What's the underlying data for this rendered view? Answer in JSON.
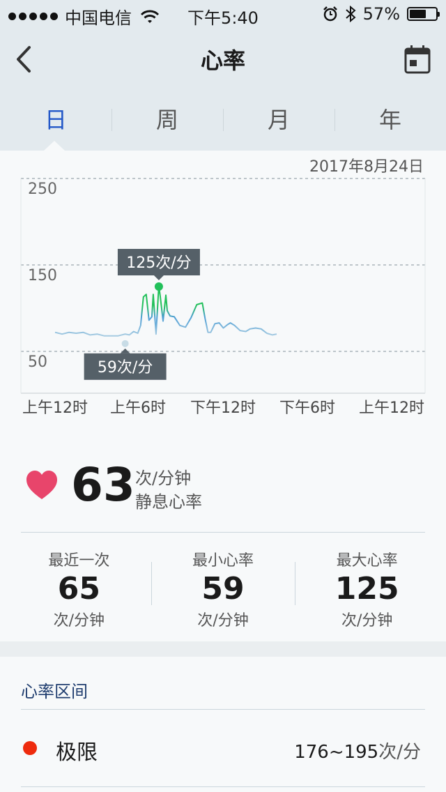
{
  "status_bar": {
    "carrier": "中国电信",
    "time": "下午5:40",
    "battery": "57%",
    "battery_level": 0.57
  },
  "nav": {
    "title": "心率"
  },
  "tabs": [
    {
      "label": "日",
      "active": true
    },
    {
      "label": "周",
      "active": false
    },
    {
      "label": "月",
      "active": false
    },
    {
      "label": "年",
      "active": false
    }
  ],
  "chart_data": {
    "type": "line",
    "date": "2017年8月24日",
    "ylim": [
      50,
      250
    ],
    "y_ticks": [
      "250",
      "150",
      "50"
    ],
    "x_tick_labels": [
      "上午12时",
      "上午6时",
      "下午12时",
      "下午6时",
      "上午12时"
    ],
    "x_range_hours": [
      0,
      24
    ],
    "series": [
      {
        "x": [
          0,
          0.5,
          1,
          1.5,
          2,
          2.5,
          3,
          3.5,
          4,
          4.5,
          5,
          5.3,
          5.6,
          5.9,
          6.1,
          6.3,
          6.5,
          6.7,
          6.9,
          7.0,
          7.2,
          7.4,
          7.5,
          7.7,
          7.9,
          8.0,
          8.2,
          8.5,
          8.9,
          9.3,
          9.7,
          10.1,
          10.5,
          10.7,
          10.9,
          11.1,
          11.4,
          11.7,
          12.0,
          12.3,
          12.5,
          12.8,
          13.2,
          13.6,
          13.9,
          14.3,
          14.7,
          15.1,
          15.5,
          15.8
        ],
        "y": [
          72,
          70,
          72,
          71,
          72,
          69,
          70,
          68,
          68,
          68,
          70,
          69,
          73,
          71,
          80,
          113,
          116,
          86,
          90,
          116,
          70,
          126,
          114,
          85,
          115,
          97,
          91,
          90,
          80,
          78,
          89,
          104,
          106,
          88,
          72,
          72,
          82,
          83,
          77,
          81,
          83,
          80,
          74,
          73,
          76,
          77,
          76,
          71,
          69,
          70
        ]
      }
    ],
    "annotations": [
      {
        "label": "125次/分",
        "x": 7.4,
        "y": 125,
        "kind": "max"
      },
      {
        "label": "59次/分",
        "x": 5.0,
        "y": 59,
        "kind": "min"
      }
    ]
  },
  "resting": {
    "value": "63",
    "unit": "次/分钟",
    "label": "静息心率"
  },
  "stats": [
    {
      "label": "最近一次",
      "value": "65",
      "unit": "次/分钟"
    },
    {
      "label": "最小心率",
      "value": "59",
      "unit": "次/分钟"
    },
    {
      "label": "最大心率",
      "value": "125",
      "unit": "次/分钟"
    }
  ],
  "zones": {
    "title": "心率区间",
    "items": [
      {
        "name": "极限",
        "range": "176~195",
        "unit": "次/分",
        "color": "#ee2b0d"
      }
    ]
  },
  "colors": {
    "accent": "#2458c8",
    "heart": "#e8456b",
    "line_high": "#22c05a",
    "line_mid": "#4f9fd5",
    "line_low": "#c8dce6",
    "tooltip": "#556068"
  }
}
